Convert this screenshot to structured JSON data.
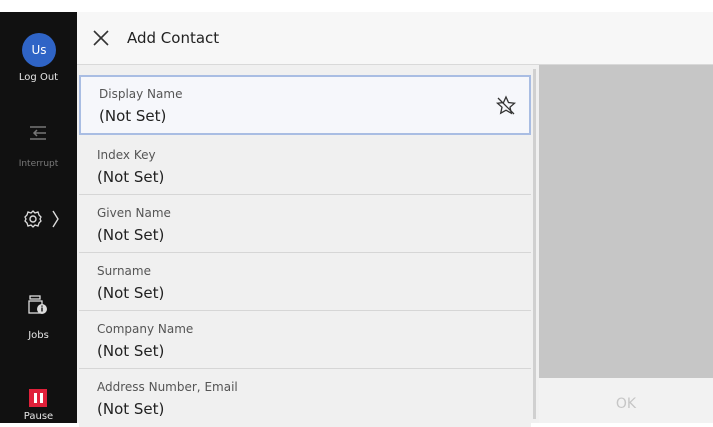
{
  "sidebar": {
    "avatar_initials": "Us",
    "logout_label": "Log Out",
    "interrupt_label": "Interrupt",
    "jobs_label": "Jobs",
    "pause_label": "Pause"
  },
  "header": {
    "title": "Add Contact"
  },
  "fields": [
    {
      "label": "Display Name",
      "value": "(Not Set)"
    },
    {
      "label": "Index Key",
      "value": "(Not Set)"
    },
    {
      "label": "Given Name",
      "value": "(Not Set)"
    },
    {
      "label": "Surname",
      "value": "(Not Set)"
    },
    {
      "label": "Company Name",
      "value": "(Not Set)"
    },
    {
      "label": "Address Number, Email",
      "value": "(Not Set)"
    }
  ],
  "footer": {
    "ok_label": "OK"
  },
  "colors": {
    "avatar": "#2f64c6",
    "pause": "#e0203a",
    "selected_border": "#a9bde3"
  }
}
